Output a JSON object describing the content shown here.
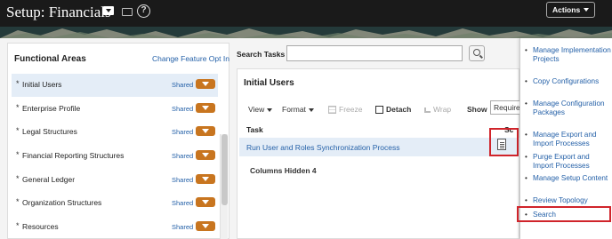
{
  "header": {
    "title": "Setup: Financials",
    "actions_label": "Actions",
    "help_glyph": "?"
  },
  "icons": {
    "title_menu": "dropdown-caret-icon",
    "tasks": "task-list-icon",
    "help": "help-icon",
    "search": "magnifier-icon",
    "task_doc": "document-icon"
  },
  "functional_areas": {
    "title": "Functional Areas",
    "change_feature_link": "Change Feature Opt In",
    "items": [
      {
        "label": "Initial Users",
        "status": "Shared"
      },
      {
        "label": "Enterprise Profile",
        "status": "Shared"
      },
      {
        "label": "Legal Structures",
        "status": "Shared"
      },
      {
        "label": "Financial Reporting Structures",
        "status": "Shared"
      },
      {
        "label": "General Ledger",
        "status": "Shared"
      },
      {
        "label": "Organization Structures",
        "status": "Shared"
      },
      {
        "label": "Resources",
        "status": "Shared"
      }
    ]
  },
  "search": {
    "label": "Search Tasks",
    "value": ""
  },
  "tasks": {
    "title": "Initial Users",
    "toolbar": {
      "view": "View",
      "format": "Format",
      "freeze": "Freeze",
      "detach": "Detach",
      "wrap": "Wrap",
      "show": "Show",
      "show_value": "Required"
    },
    "columns": {
      "task": "Task",
      "scope": "Sc"
    },
    "rows": [
      {
        "task": "Run User and Roles Synchronization Process"
      }
    ],
    "columns_hidden": "Columns Hidden  4"
  },
  "actions_menu": {
    "items": [
      "Manage Implementation Projects",
      "Copy Configurations",
      "Manage Configuration Packages",
      "Manage Export and Import Processes",
      "Purge Export and Import Processes",
      "Manage Setup Content",
      "Review Topology",
      "Search"
    ]
  },
  "colors": {
    "header_bg": "#1a1a1a",
    "link": "#2561a8",
    "status_badge": "#c8751f",
    "selected_row": "#e4edf7",
    "highlight": "#d0242b"
  }
}
